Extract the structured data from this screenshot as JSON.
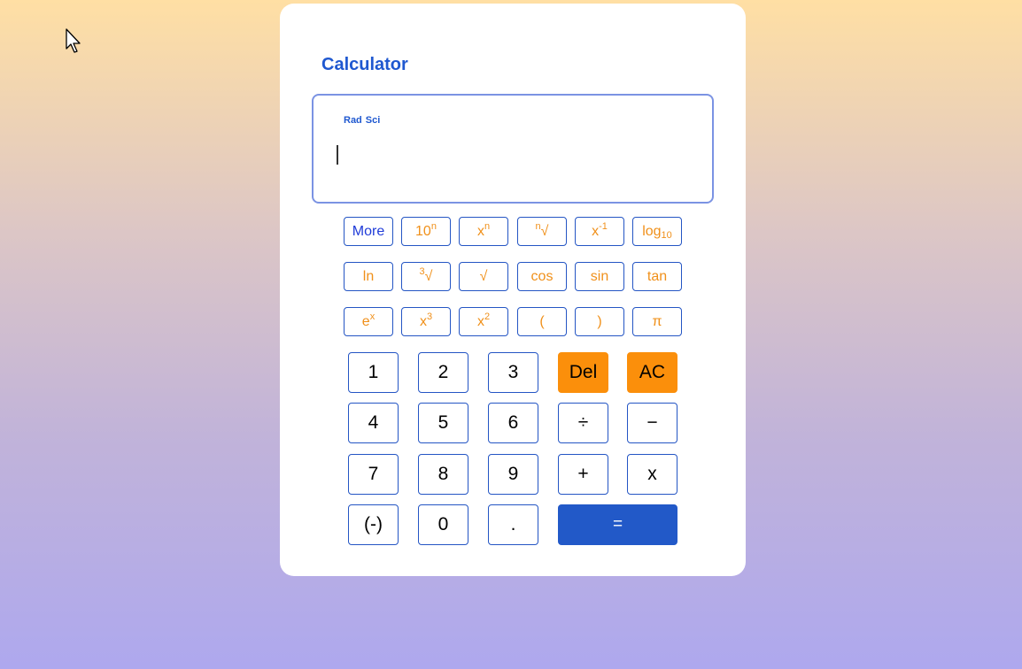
{
  "app": {
    "title": "Calculator"
  },
  "display": {
    "mode_angle": "Rad",
    "mode_notation": "Sci",
    "expression": ""
  },
  "scientific_keys": [
    {
      "name": "more",
      "label": "More"
    },
    {
      "name": "ten-power",
      "base": "10",
      "sup": "n"
    },
    {
      "name": "x-power-n",
      "base": "x",
      "sup": "n"
    },
    {
      "name": "nth-root",
      "pre_sup": "n",
      "base": "√"
    },
    {
      "name": "reciprocal",
      "base": "x",
      "sup": "-1"
    },
    {
      "name": "log10",
      "base": "log",
      "sub": "10"
    },
    {
      "name": "ln",
      "label": "ln"
    },
    {
      "name": "cube-root",
      "pre_sup": "3",
      "base": "√"
    },
    {
      "name": "square-root",
      "label": "√"
    },
    {
      "name": "cos",
      "label": "cos"
    },
    {
      "name": "sin",
      "label": "sin"
    },
    {
      "name": "tan",
      "label": "tan"
    },
    {
      "name": "exp",
      "base": "e",
      "sup": "x"
    },
    {
      "name": "cube",
      "base": "x",
      "sup": "3"
    },
    {
      "name": "square",
      "base": "x",
      "sup": "2"
    },
    {
      "name": "open-paren",
      "label": "("
    },
    {
      "name": "close-paren",
      "label": ")"
    },
    {
      "name": "pi",
      "label": "π"
    }
  ],
  "keypad": {
    "one": "1",
    "two": "2",
    "three": "3",
    "delete": "Del",
    "clear": "AC",
    "four": "4",
    "five": "5",
    "six": "6",
    "divide": "÷",
    "minus": "−",
    "seven": "7",
    "eight": "8",
    "nine": "9",
    "plus": "+",
    "multiply": "x",
    "negate": "(-)",
    "zero": "0",
    "decimal": ".",
    "equals": "="
  },
  "colors": {
    "accent_blue": "#1f58d0",
    "orange": "#fb8f0b",
    "equals_blue": "#2259c8"
  }
}
